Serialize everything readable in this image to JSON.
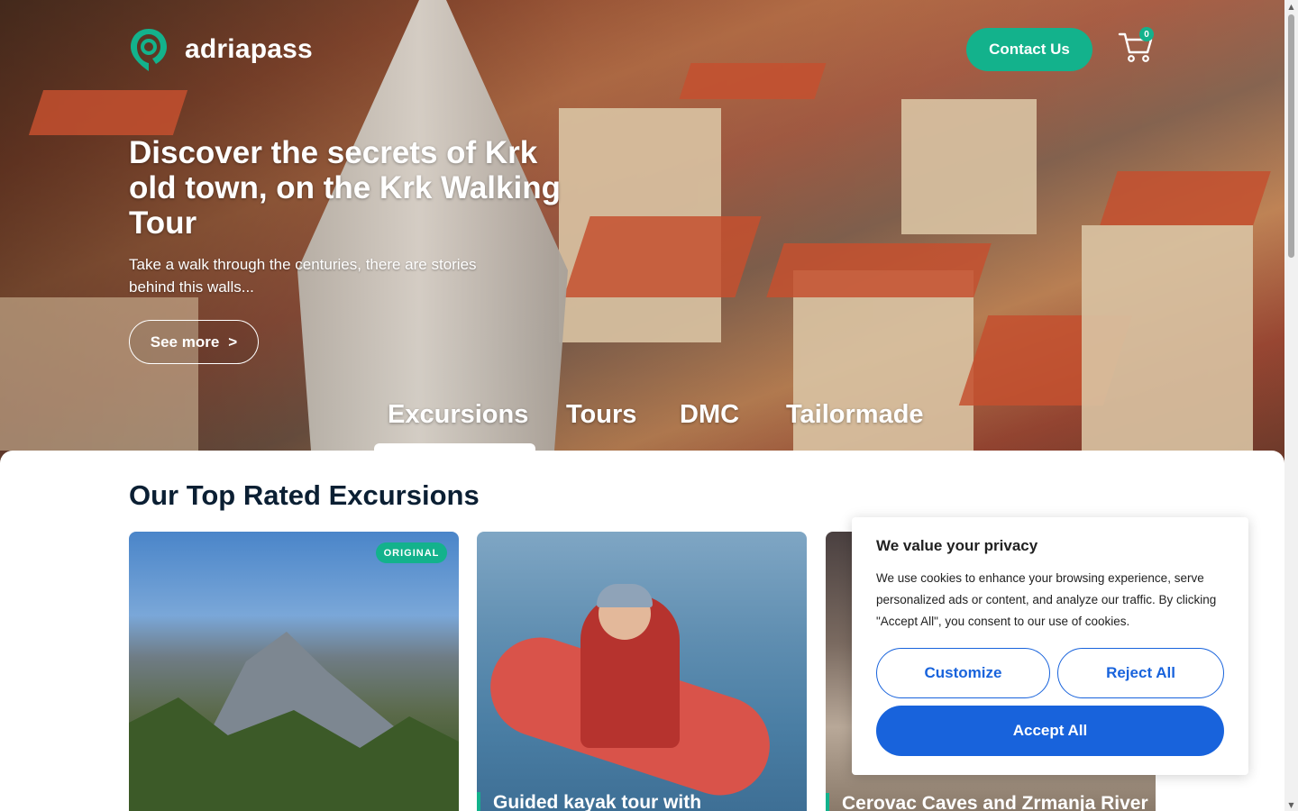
{
  "brand": {
    "name": "adriapass"
  },
  "header": {
    "contact_label": "Contact Us",
    "cart_count": "0"
  },
  "hero": {
    "title": "Discover the secrets of Krk old town, on the Krk Walking Tour",
    "subtitle": "Take a walk through the centuries, there are stories behind this walls...",
    "see_more_label": "See more",
    "see_more_arrow": ">"
  },
  "tabs": [
    {
      "label": "Excursions",
      "active": true
    },
    {
      "label": "Tours",
      "active": false
    },
    {
      "label": "DMC",
      "active": false
    },
    {
      "label": "Tailormade",
      "active": false
    }
  ],
  "section": {
    "title": "Our Top Rated Excursions"
  },
  "cards": [
    {
      "badge": "ORIGINAL",
      "title": ""
    },
    {
      "badge": "",
      "title": "Guided kayak tour with"
    },
    {
      "badge": "",
      "title": "Cerovac Caves and Zrmanja River"
    }
  ],
  "cookie": {
    "title": "We value your privacy",
    "text": "We use cookies to enhance your browsing experience, serve personalized ads or content, and analyze our traffic. By clicking \"Accept All\", you consent to our use of cookies.",
    "customize_label": "Customize",
    "reject_label": "Reject All",
    "accept_label": "Accept All"
  },
  "colors": {
    "accent": "#13b28c",
    "cookie_blue": "#1863dc",
    "heading": "#0b1f33"
  }
}
